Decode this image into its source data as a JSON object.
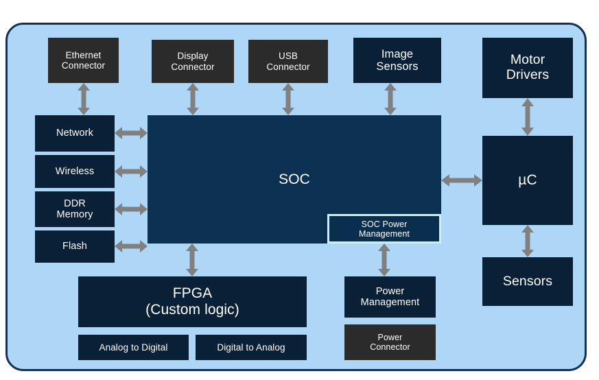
{
  "diagram": {
    "board": {
      "background_color": "#aed7f7",
      "border_color": "#12304f"
    },
    "colors": {
      "connector_block": "#2b2b2b",
      "internal_block": "#0a2036",
      "soc_block": "#0d3152",
      "highlight_border": "#cdeef7",
      "arrow": "#808080",
      "text": "#ffffff"
    },
    "blocks": [
      {
        "id": "ethernet_connector",
        "label": "Ethernet\nConnector",
        "style": "charcoal"
      },
      {
        "id": "display_connector",
        "label": "Display\nConnector",
        "style": "charcoal"
      },
      {
        "id": "usb_connector",
        "label": "USB\nConnector",
        "style": "charcoal"
      },
      {
        "id": "image_sensors",
        "label": "Image\nSensors",
        "style": "navy"
      },
      {
        "id": "motor_drivers",
        "label": "Motor\nDrivers",
        "style": "navy"
      },
      {
        "id": "network",
        "label": "Network",
        "style": "navy"
      },
      {
        "id": "wireless",
        "label": "Wireless",
        "style": "navy"
      },
      {
        "id": "ddr_memory",
        "label": "DDR\nMemory",
        "style": "navy"
      },
      {
        "id": "flash",
        "label": "Flash",
        "style": "navy"
      },
      {
        "id": "soc",
        "label": "SOC",
        "style": "soc"
      },
      {
        "id": "soc_power_management",
        "label": "SOC Power\nManagement",
        "style": "outlined"
      },
      {
        "id": "microcontroller",
        "label": "µC",
        "style": "navy"
      },
      {
        "id": "sensors",
        "label": "Sensors",
        "style": "navy"
      },
      {
        "id": "fpga",
        "label": "FPGA\n(Custom logic)",
        "style": "navy"
      },
      {
        "id": "analog_to_digital",
        "label": "Analog to Digital",
        "style": "navy"
      },
      {
        "id": "digital_to_analog",
        "label": "Digital to Analog",
        "style": "navy"
      },
      {
        "id": "power_management",
        "label": "Power\nManagement",
        "style": "navy"
      },
      {
        "id": "power_connector",
        "label": "Power\nConnector",
        "style": "charcoal"
      }
    ],
    "connections": [
      {
        "from": "ethernet_connector",
        "to": "network",
        "direction": "bidirectional",
        "orientation": "vertical"
      },
      {
        "from": "display_connector",
        "to": "soc",
        "direction": "bidirectional",
        "orientation": "vertical"
      },
      {
        "from": "usb_connector",
        "to": "soc",
        "direction": "bidirectional",
        "orientation": "vertical"
      },
      {
        "from": "image_sensors",
        "to": "soc",
        "direction": "bidirectional",
        "orientation": "vertical"
      },
      {
        "from": "network",
        "to": "soc",
        "direction": "bidirectional",
        "orientation": "horizontal"
      },
      {
        "from": "wireless",
        "to": "soc",
        "direction": "bidirectional",
        "orientation": "horizontal"
      },
      {
        "from": "ddr_memory",
        "to": "soc",
        "direction": "bidirectional",
        "orientation": "horizontal"
      },
      {
        "from": "flash",
        "to": "soc",
        "direction": "bidirectional",
        "orientation": "horizontal"
      },
      {
        "from": "soc",
        "to": "microcontroller",
        "direction": "bidirectional",
        "orientation": "horizontal"
      },
      {
        "from": "soc",
        "to": "fpga",
        "direction": "bidirectional",
        "orientation": "vertical"
      },
      {
        "from": "soc_power_management",
        "to": "power_management",
        "direction": "bidirectional",
        "orientation": "vertical"
      },
      {
        "from": "motor_drivers",
        "to": "microcontroller",
        "direction": "bidirectional",
        "orientation": "vertical"
      },
      {
        "from": "microcontroller",
        "to": "sensors",
        "direction": "bidirectional",
        "orientation": "vertical"
      }
    ]
  }
}
